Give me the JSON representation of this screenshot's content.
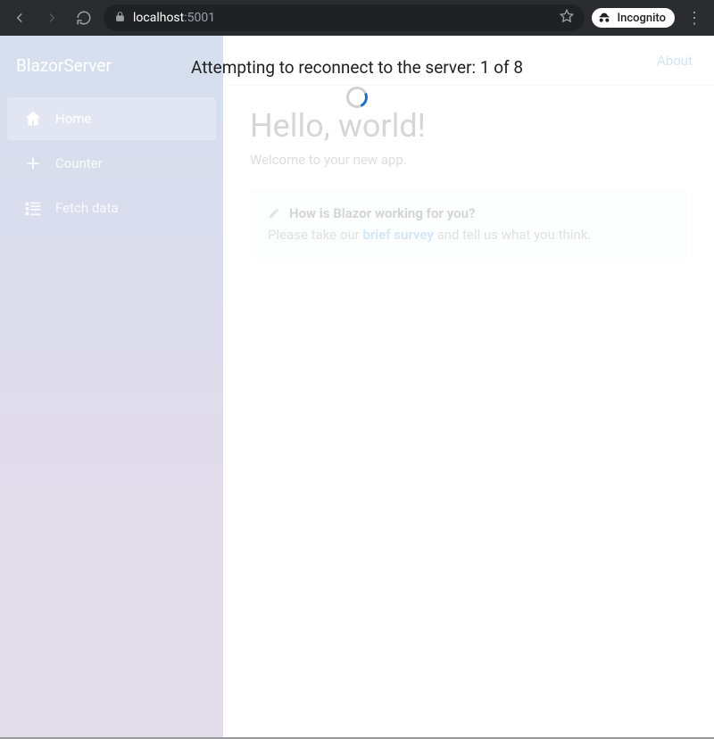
{
  "browser": {
    "url_host": "localhost",
    "url_port": ":5001",
    "incognito_label": "Incognito"
  },
  "reconnect": {
    "message": "Attempting to reconnect to the server: 1 of 8"
  },
  "sidebar": {
    "brand": "BlazorServer",
    "items": [
      {
        "label": "Home"
      },
      {
        "label": "Counter"
      },
      {
        "label": "Fetch data"
      }
    ]
  },
  "header": {
    "about_label": "About"
  },
  "main": {
    "heading": "Hello, world!",
    "welcome": "Welcome to your new app.",
    "survey": {
      "title": "How is Blazor working for you?",
      "text_before": "Please take our ",
      "link_text": "brief survey",
      "text_after": " and tell us what you think."
    }
  }
}
